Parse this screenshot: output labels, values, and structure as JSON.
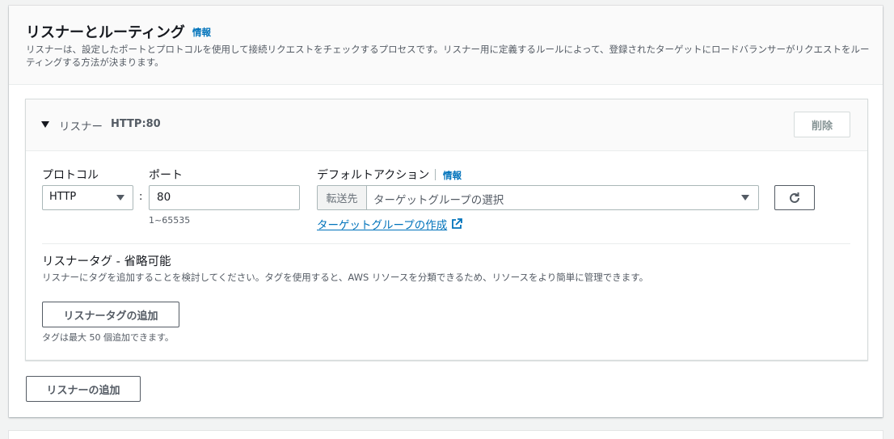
{
  "section": {
    "title": "リスナーとルーティング",
    "info": "情報",
    "description": "リスナーは、設定したポートとプロトコルを使用して接続リクエストをチェックするプロセスです。リスナー用に定義するルールによって、登録されたターゲットにロードバランサーがリクエストをルーティングする方法が決まります。"
  },
  "listener": {
    "label": "リスナー",
    "protocol_port": "HTTP:80",
    "delete_label": "削除",
    "protocol_label": "プロトコル",
    "protocol_value": "HTTP",
    "port_label": "ポート",
    "port_value": "80",
    "port_hint": "1~65535",
    "default_action_label": "デフォルトアクション",
    "default_action_info": "情報",
    "forward_prefix": "転送先",
    "target_group_placeholder": "ターゲットグループの選択",
    "create_target_group_link": "ターゲットグループの作成"
  },
  "tags": {
    "title": "リスナータグ - 省略可能",
    "description": "リスナーにタグを追加することを検討してください。タグを使用すると、AWS リソースを分類できるため、リソースをより簡単に管理できます。",
    "add_button": "リスナータグの追加",
    "limit_hint": "タグは最大 50 個追加できます。"
  },
  "add_listener_button": "リスナーの追加",
  "icons": {
    "caret": "caret-down-icon",
    "dropdown": "chevron-down-icon",
    "refresh": "refresh-icon",
    "external": "external-link-icon"
  },
  "colors": {
    "link": "#0073bb",
    "border": "#aab7b8",
    "text": "#16191f",
    "muted": "#545b64"
  }
}
